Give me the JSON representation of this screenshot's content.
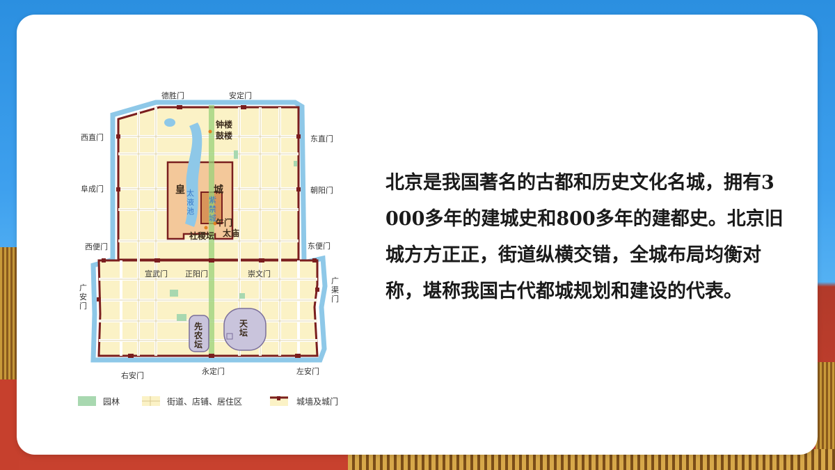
{
  "map": {
    "gates": {
      "deshengmen": "德胜门",
      "andingmen": "安定门",
      "xizhimen": "西直门",
      "dongzhimen": "东直门",
      "fuchengmen": "阜成门",
      "chaoyangmen": "朝阳门",
      "xibianmen": "西便门",
      "dongbianmen": "东便门",
      "guanganmen": "广\n安\n门",
      "guangqumen": "广\n渠\n门",
      "xuanwumen": "宣武门",
      "zhengyangmen": "正阳门",
      "chongwenmen": "崇文门",
      "youanmen": "右安门",
      "yongdingmen": "永定门",
      "zuoanmen": "左安门"
    },
    "places": {
      "zhonglou": "钟楼",
      "gulou": "鼓楼",
      "huang": "皇",
      "cheng": "城",
      "zijincheng": "紫禁城",
      "taiyechi": "太液池",
      "wumen": "午门",
      "shejitan": "社稷坛",
      "taimiao": "太庙",
      "tiantan": "天坛",
      "xiannongtan": "先农坛"
    },
    "legend": {
      "garden": "园林",
      "streets": "街道、店铺、居住区",
      "walls": "城墙及城门"
    },
    "colors": {
      "wall": "#7a1e1e",
      "moat": "#8ec8e8",
      "city_fill": "#fbf2c6",
      "imperial_fill": "#f3c89a",
      "garden": "#a8d8b0",
      "axis": "#9ad27a"
    }
  },
  "body_text": "北京是我国著名的古都和历史文化名城，拥有3 000多年的建城史和800多年的建都史。北京旧城方方正正，街道纵横交错，全城布局均衡对称，堪称我国古代都城规划和建设的代表。"
}
